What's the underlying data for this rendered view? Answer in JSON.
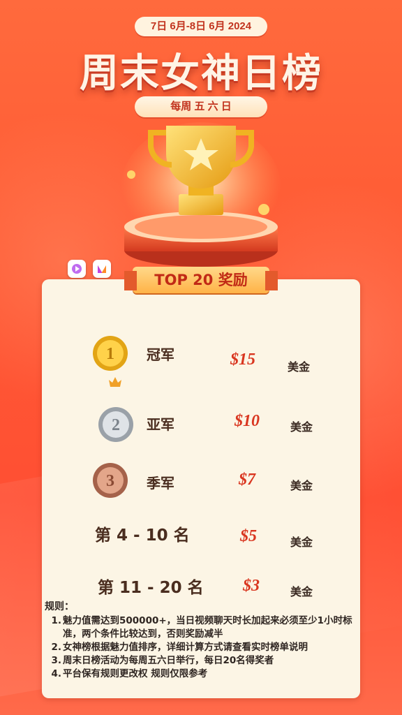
{
  "header": {
    "date_range": "7日 6月-8日 6月 2024",
    "title": "周末女神日榜",
    "subtitle": "每周 五 六 日"
  },
  "banner": {
    "label": "TOP 20 奖励"
  },
  "colors": {
    "accent": "#ff5a34",
    "amount": "#d9351f",
    "card": "#fcf5e5"
  },
  "rewards": [
    {
      "rank": "冠军",
      "amount": "$15",
      "currency": "美金",
      "medal_number": "1",
      "medal": "gold-medal"
    },
    {
      "rank": "亚军",
      "amount": "$10",
      "currency": "美金",
      "medal_number": "2",
      "medal": "silver-medal"
    },
    {
      "rank": "季军",
      "amount": "$7",
      "currency": "美金",
      "medal_number": "3",
      "medal": "bronze-medal"
    },
    {
      "rank": "第 4 - 10 名",
      "amount": "$5",
      "currency": "美金"
    },
    {
      "rank": "第 11 - 20 名",
      "amount": "$3",
      "currency": "美金"
    }
  ],
  "rules": {
    "title": "规则：",
    "items": [
      {
        "num": "1.",
        "text": "魅力值需达到500000+，当日视频聊天时长加起来必须至少1小时标准，两个条件比较达到，否则奖励减半"
      },
      {
        "num": "2.",
        "text": "女神榜根据魅力值排序，详细计算方式请查看实时榜单说明"
      },
      {
        "num": "3.",
        "text": "周末日榜活动为每周五六日举行，每日20名得奖者"
      },
      {
        "num": "4.",
        "text": "平台保有规则更改权 规则仅限参考"
      }
    ]
  }
}
